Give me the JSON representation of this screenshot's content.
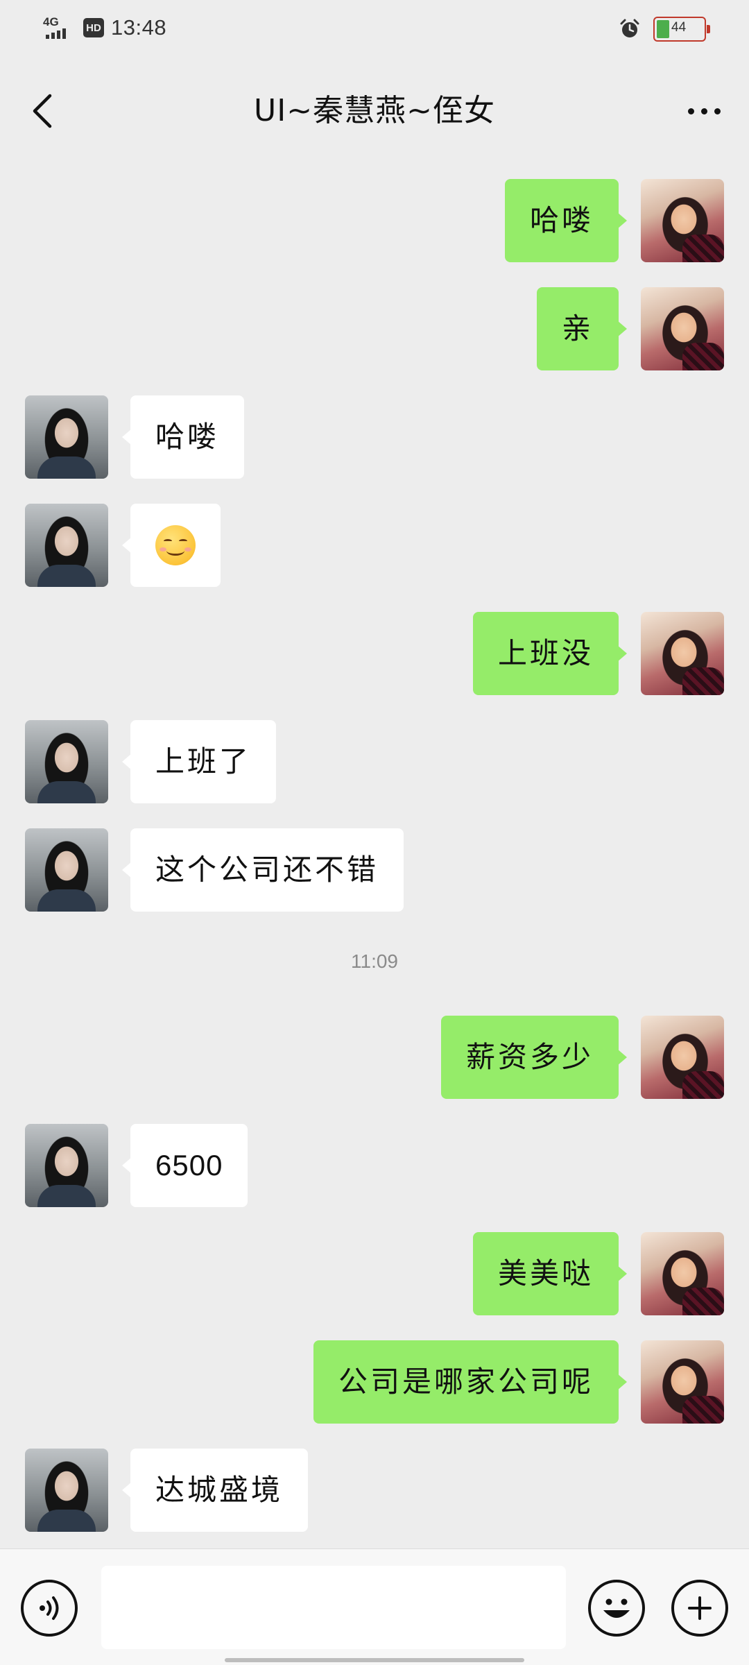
{
  "status_bar": {
    "network": "4G",
    "hd": "HD",
    "time": "13:48",
    "battery": "44",
    "battery_level": 0.44
  },
  "header": {
    "title": "UI~秦慧燕~侄女",
    "back_icon": "chevron-left-icon",
    "more_icon": "more-dots-icon"
  },
  "messages": [
    {
      "from": "me",
      "text": "哈喽"
    },
    {
      "from": "me",
      "text": "亲"
    },
    {
      "from": "them",
      "text": "哈喽"
    },
    {
      "from": "them",
      "emoji": "smile-emoji"
    },
    {
      "from": "me",
      "text": "上班没"
    },
    {
      "from": "them",
      "text": "上班了"
    },
    {
      "from": "them",
      "text": "这个公司还不错"
    },
    {
      "from": "me",
      "text": "薪资多少"
    },
    {
      "from": "them",
      "text": "6500"
    },
    {
      "from": "me",
      "text": "美美哒"
    },
    {
      "from": "me",
      "text": "公司是哪家公司呢"
    },
    {
      "from": "them",
      "text": "达城盛境"
    }
  ],
  "timestamp": "11:09",
  "input_bar": {
    "value": "",
    "voice_icon": "voice-icon",
    "emoji_icon": "emoji-icon",
    "plus_icon": "plus-icon"
  },
  "colors": {
    "background": "#ededed",
    "outgoing_bubble": "#95ec69",
    "incoming_bubble": "#ffffff",
    "battery_fill": "#4cae4c"
  }
}
